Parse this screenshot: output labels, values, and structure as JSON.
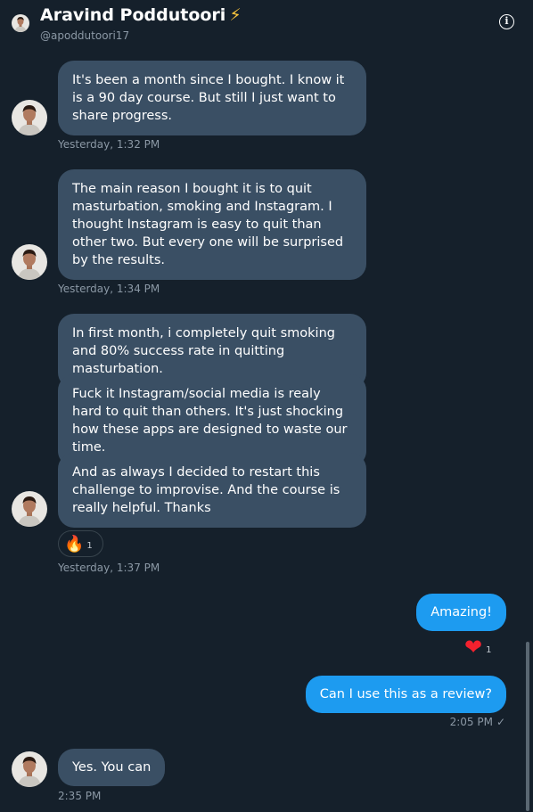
{
  "header": {
    "name": "Aravind Poddutoori",
    "emoji": "⚡",
    "handle": "@apoddutoori17",
    "info_icon": "i"
  },
  "messages": [
    {
      "text": "It's been a month since I bought. I know it is a 90 day course. But still I just want to share progress."
    },
    {
      "text": "The main reason I bought it is to quit masturbation, smoking and Instagram. I thought Instagram is easy to quit than other two. But every one will be surprised by the results."
    },
    {
      "text": "In first month, i completely quit smoking and 80% success rate in quitting masturbation."
    },
    {
      "text": "Fuck it Instagram/social media is realy hard to quit than others. It's just shocking how these apps are designed to waste our time."
    },
    {
      "text": "And as always I decided to restart this challenge to improvise. And the course is really helpful. Thanks"
    },
    {
      "text": "Amazing!"
    },
    {
      "text": "Can I use this as a review?"
    },
    {
      "text": "Yes. You can"
    }
  ],
  "timestamps": {
    "t1": "Yesterday, 1:32 PM",
    "t2": "Yesterday, 1:34 PM",
    "t3": "Yesterday, 1:37 PM",
    "t4": "2:05 PM",
    "t4_status": "✓",
    "t5": "2:35 PM"
  },
  "reactions": {
    "fire": {
      "emoji": "🔥",
      "count": "1"
    },
    "heart": {
      "emoji": "❤",
      "count": "1"
    }
  },
  "colors": {
    "background": "#15202b",
    "incoming_bubble": "#3a4f64",
    "outgoing_bubble": "#1d9bf0",
    "muted_text": "#8b98a5",
    "heart": "#f4212e"
  }
}
